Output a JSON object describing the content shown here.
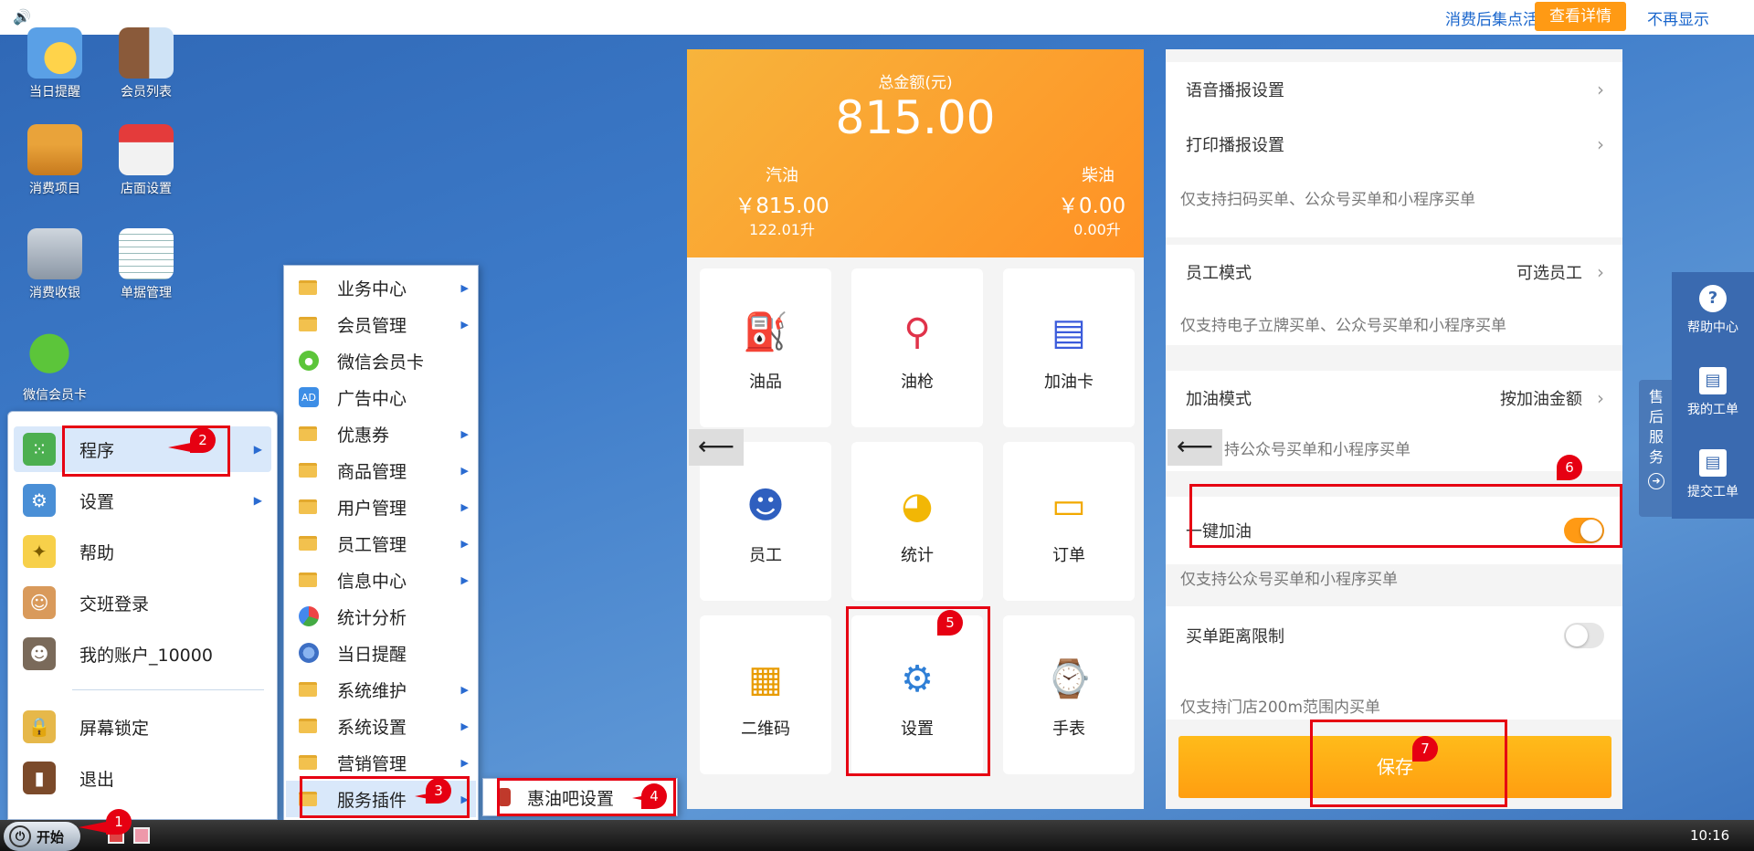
{
  "topbar": {
    "notice": "消费后集点活",
    "detail_button": "查看详情",
    "hide_link": "不再显示"
  },
  "desktop": {
    "icons": [
      {
        "label": "当日提醒",
        "icon": "bell-reminder-icon"
      },
      {
        "label": "会员列表",
        "icon": "member-list-icon"
      },
      {
        "label": "消费项目",
        "icon": "basket-icon"
      },
      {
        "label": "店面设置",
        "icon": "store-icon"
      },
      {
        "label": "消费收银",
        "icon": "cash-register-icon"
      },
      {
        "label": "单据管理",
        "icon": "notebook-icon"
      },
      {
        "label": "微信会员卡",
        "icon": "wechat-icon"
      }
    ]
  },
  "start_menu": {
    "items": [
      {
        "label": "程序",
        "icon": "grid-icon"
      },
      {
        "label": "设置",
        "icon": "gear-icon"
      },
      {
        "label": "帮助",
        "icon": "lightbulb-icon"
      },
      {
        "label": "交班登录",
        "icon": "users-icon"
      },
      {
        "label": "我的账户_10000",
        "icon": "account-icon"
      },
      {
        "label": "屏幕锁定",
        "icon": "lock-icon"
      },
      {
        "label": "退出",
        "icon": "exit-door-icon"
      }
    ]
  },
  "program_menu": {
    "items": [
      {
        "label": "业务中心",
        "icon": "folder-icon"
      },
      {
        "label": "会员管理",
        "icon": "folder-icon"
      },
      {
        "label": "微信会员卡",
        "icon": "wechat-icon"
      },
      {
        "label": "广告中心",
        "icon": "ad-icon",
        "icon_text": "AD"
      },
      {
        "label": "优惠券",
        "icon": "folder-icon"
      },
      {
        "label": "商品管理",
        "icon": "folder-icon"
      },
      {
        "label": "用户管理",
        "icon": "folder-icon"
      },
      {
        "label": "员工管理",
        "icon": "folder-icon"
      },
      {
        "label": "信息中心",
        "icon": "folder-icon"
      },
      {
        "label": "统计分析",
        "icon": "chart-icon"
      },
      {
        "label": "当日提醒",
        "icon": "reminder-icon"
      },
      {
        "label": "系统维护",
        "icon": "folder-icon"
      },
      {
        "label": "系统设置",
        "icon": "folder-icon"
      },
      {
        "label": "营销管理",
        "icon": "folder-icon"
      },
      {
        "label": "服务插件",
        "icon": "folder-icon"
      }
    ]
  },
  "plugin_menu": {
    "item": "惠油吧设置"
  },
  "taskbar": {
    "start_label": "开始",
    "clock": "10:16"
  },
  "panel1": {
    "total_label": "总金额(元)",
    "total_value": "815.00",
    "gasoline_label": "汽油",
    "gasoline_amount": "￥815.00",
    "gasoline_volume": "122.01升",
    "diesel_label": "柴油",
    "diesel_amount": "￥0.00",
    "diesel_volume": "0.00升",
    "back_arrow": "⟵",
    "tiles": [
      {
        "label": "油品",
        "icon": "oil-can-icon"
      },
      {
        "label": "油枪",
        "icon": "fuel-nozzle-icon"
      },
      {
        "label": "加油卡",
        "icon": "fuel-card-icon"
      },
      {
        "label": "员工",
        "icon": "employee-icon"
      },
      {
        "label": "统计",
        "icon": "pie-chart-icon"
      },
      {
        "label": "订单",
        "icon": "order-icon"
      },
      {
        "label": "二维码",
        "icon": "qrcode-icon"
      },
      {
        "label": "设置",
        "icon": "settings-gear-icon"
      },
      {
        "label": "手表",
        "icon": "watch-icon"
      }
    ]
  },
  "panel2": {
    "voice_setting": "语音播报设置",
    "print_setting": "打印播报设置",
    "hint1": "仅支持扫码买单、公众号买单和小程序买单",
    "employee_mode_label": "员工模式",
    "employee_mode_value": "可选员工",
    "hint2": "仅支持电子立牌买单、公众号买单和小程序买单",
    "fuel_mode_label": "加油模式",
    "fuel_mode_value": "按加油金额",
    "hint3": "持公众号买单和小程序买单",
    "one_key_label": "一键加油",
    "one_key_on": true,
    "hint4": "仅支持公众号买单和小程序买单",
    "distance_label": "买单距离限制",
    "distance_on": false,
    "hint5": "仅支持门店200m范围内买单",
    "save_button": "保存",
    "back_arrow": "⟵"
  },
  "service_tab": {
    "label": "售后服务"
  },
  "help_bar": {
    "items": [
      {
        "label": "帮助中心",
        "icon": "question-icon",
        "glyph": "?"
      },
      {
        "label": "我的工单",
        "icon": "clipboard-icon",
        "glyph": "▤"
      },
      {
        "label": "提交工单",
        "icon": "submit-clipboard-icon",
        "glyph": "▤"
      }
    ]
  },
  "annotations": [
    "1",
    "2",
    "3",
    "4",
    "5",
    "6",
    "7"
  ],
  "colors": {
    "accent": "#ff9a14",
    "annotation": "#e60012",
    "link": "#1a66cc",
    "toggle_on": "#ff9a14"
  }
}
